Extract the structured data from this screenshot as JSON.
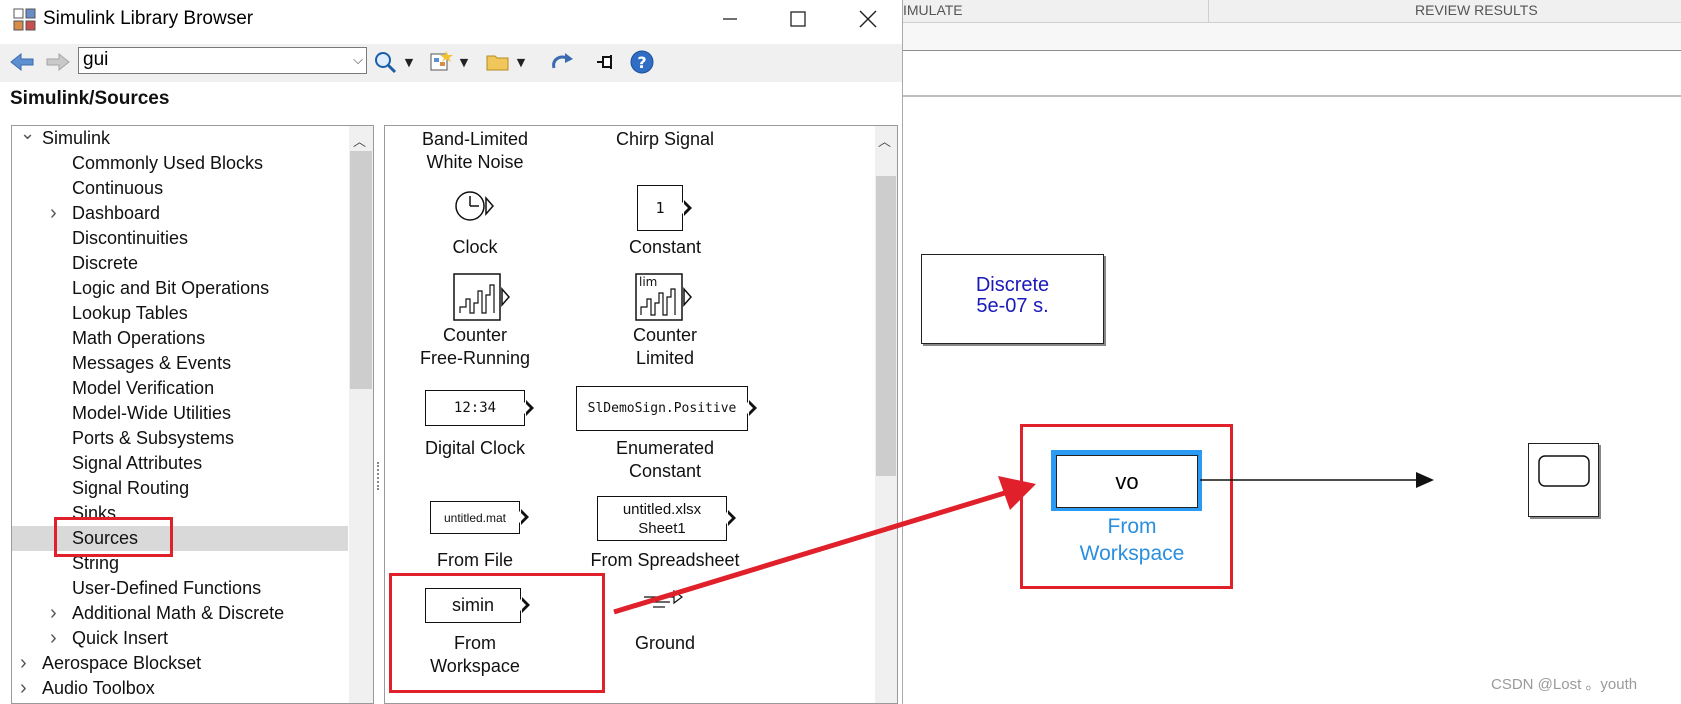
{
  "window": {
    "title": "Simulink Library Browser",
    "minimize_icon": "minimize-icon",
    "maximize_icon": "maximize-icon",
    "close_icon": "close-icon"
  },
  "toolbar": {
    "search_value": "gui",
    "icons": [
      "back-arrow-icon",
      "forward-arrow-icon",
      "search-icon",
      "new-model-icon",
      "open-folder-icon",
      "refresh-icon",
      "pin-icon",
      "help-icon"
    ]
  },
  "breadcrumb": "Simulink/Sources",
  "tree": {
    "items": [
      {
        "label": "Simulink",
        "level": 0,
        "expander": "expanded"
      },
      {
        "label": "Commonly Used Blocks",
        "level": 1,
        "expander": "none"
      },
      {
        "label": "Continuous",
        "level": 1,
        "expander": "none"
      },
      {
        "label": "Dashboard",
        "level": 1,
        "expander": "collapsed"
      },
      {
        "label": "Discontinuities",
        "level": 1,
        "expander": "none"
      },
      {
        "label": "Discrete",
        "level": 1,
        "expander": "none"
      },
      {
        "label": "Logic and Bit Operations",
        "level": 1,
        "expander": "none"
      },
      {
        "label": "Lookup Tables",
        "level": 1,
        "expander": "none"
      },
      {
        "label": "Math Operations",
        "level": 1,
        "expander": "none"
      },
      {
        "label": "Messages & Events",
        "level": 1,
        "expander": "none"
      },
      {
        "label": "Model Verification",
        "level": 1,
        "expander": "none"
      },
      {
        "label": "Model-Wide Utilities",
        "level": 1,
        "expander": "none"
      },
      {
        "label": "Ports & Subsystems",
        "level": 1,
        "expander": "none"
      },
      {
        "label": "Signal Attributes",
        "level": 1,
        "expander": "none"
      },
      {
        "label": "Signal Routing",
        "level": 1,
        "expander": "none"
      },
      {
        "label": "Sinks",
        "level": 1,
        "expander": "none"
      },
      {
        "label": "Sources",
        "level": 1,
        "expander": "none"
      },
      {
        "label": "String",
        "level": 1,
        "expander": "none"
      },
      {
        "label": "User-Defined Functions",
        "level": 1,
        "expander": "none"
      },
      {
        "label": "Additional Math & Discrete",
        "level": 1,
        "expander": "collapsed"
      },
      {
        "label": "Quick Insert",
        "level": 1,
        "expander": "collapsed"
      },
      {
        "label": "Aerospace Blockset",
        "level": 0,
        "expander": "collapsed"
      },
      {
        "label": "Audio Toolbox",
        "level": 0,
        "expander": "collapsed"
      }
    ],
    "selected": "Sources"
  },
  "blocks": {
    "band_limited": "Band-Limited\nWhite Noise",
    "chirp": "Chirp Signal",
    "clock": "Clock",
    "constant_icon": "1",
    "constant": "Constant",
    "counter_free": "Counter\nFree-Running",
    "counter_limited_icon": "lim",
    "counter_limited": "Counter\nLimited",
    "digital_clock_icon": "12:34",
    "digital_clock": "Digital Clock",
    "enum_icon": "SlDemoSign.Positive",
    "enum": "Enumerated\nConstant",
    "from_file_icon": "untitled.mat",
    "from_file": "From File",
    "from_spreadsheet_icon": "untitled.xlsx\nSheet1",
    "from_spreadsheet": "From Spreadsheet",
    "from_workspace_icon": "simin",
    "from_workspace": "From\nWorkspace",
    "ground": "Ground"
  },
  "model": {
    "tabs": [
      "IMULATE",
      "REVIEW RESULTS"
    ],
    "powergui_text": "Discrete\n5e-07 s.",
    "from_ws_icon": "vo",
    "from_ws_label": "From\nWorkspace",
    "scope_icon": "scope-icon",
    "colors": {
      "powergui_text": "#1a1ab8",
      "selection": "#2b9af3",
      "label_blue": "#2b8fe0",
      "annotation_red": "#e0202a"
    }
  },
  "watermark": "CSDN @Lost 。youth"
}
